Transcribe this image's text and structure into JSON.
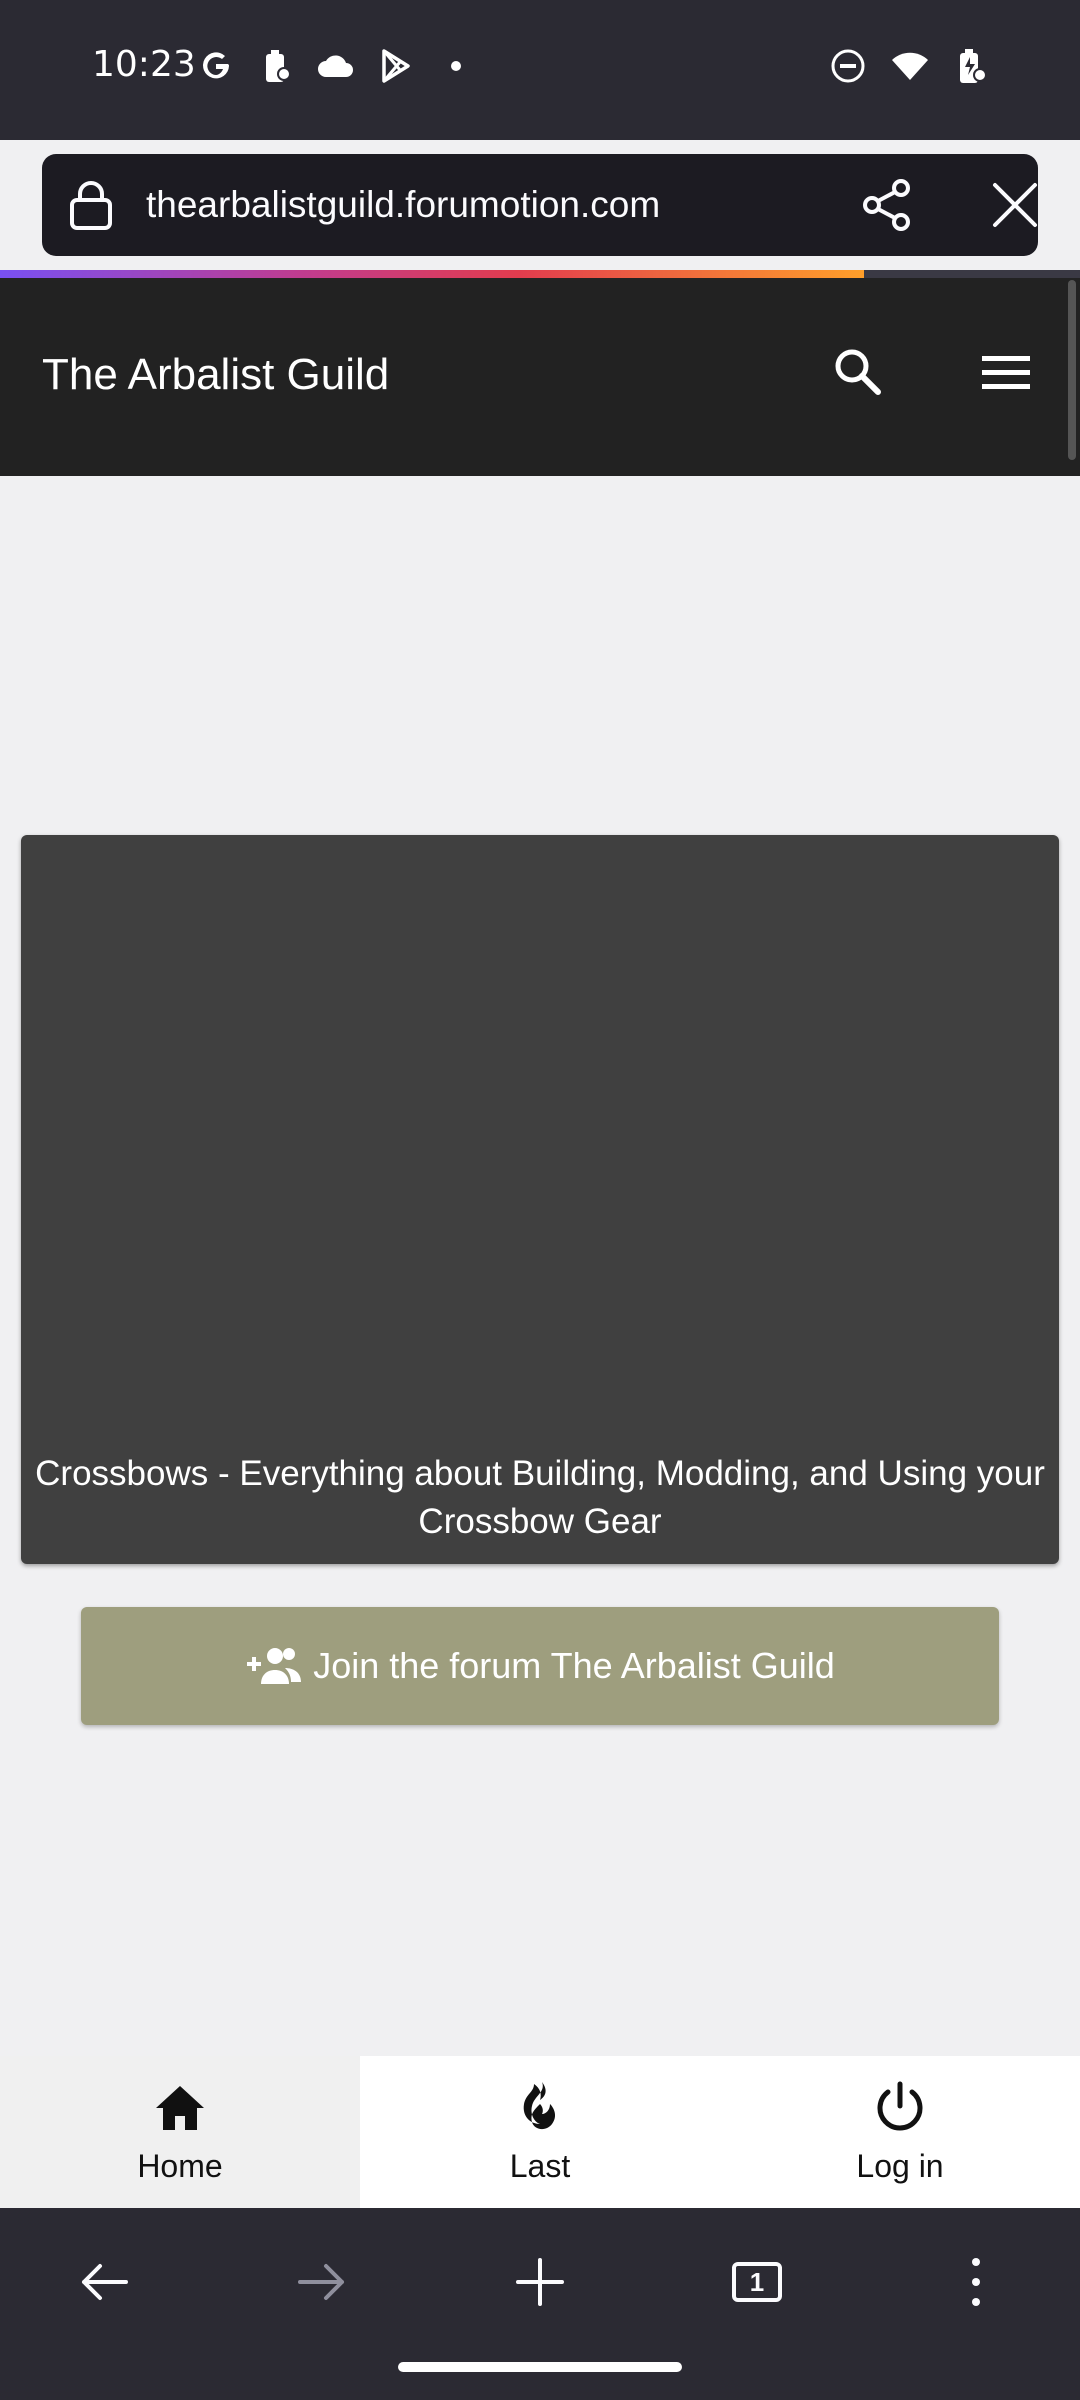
{
  "status_bar": {
    "time": "10:23",
    "left_icons": [
      "google-icon",
      "battery-saver-icon",
      "cloud-icon",
      "play-store-icon",
      "dot-icon"
    ],
    "right_icons": [
      "do-not-disturb-icon",
      "wifi-icon",
      "battery-charging-icon"
    ]
  },
  "browser": {
    "url": "thearbalistguild.forumotion.com",
    "load_progress": 0.8,
    "tab_count": "1"
  },
  "site": {
    "title": "The Arbalist Guild"
  },
  "banner": {
    "caption_line1": "Crossbows - Everything about Building, Modding, and Using your",
    "caption_line2": "Crossbow Gear"
  },
  "join_button": {
    "label": "Join the forum The Arbalist Guild"
  },
  "forum_nav": {
    "items": [
      {
        "label": "Home",
        "icon": "home-icon",
        "active": true
      },
      {
        "label": "Last",
        "icon": "flame-icon",
        "active": false
      },
      {
        "label": "Log in",
        "icon": "power-icon",
        "active": false
      }
    ]
  },
  "colors": {
    "header_bg": "#222222",
    "banner_bg": "#404040",
    "join_button_bg": "#9e9e7e",
    "browser_chrome": "#2b2a33"
  }
}
